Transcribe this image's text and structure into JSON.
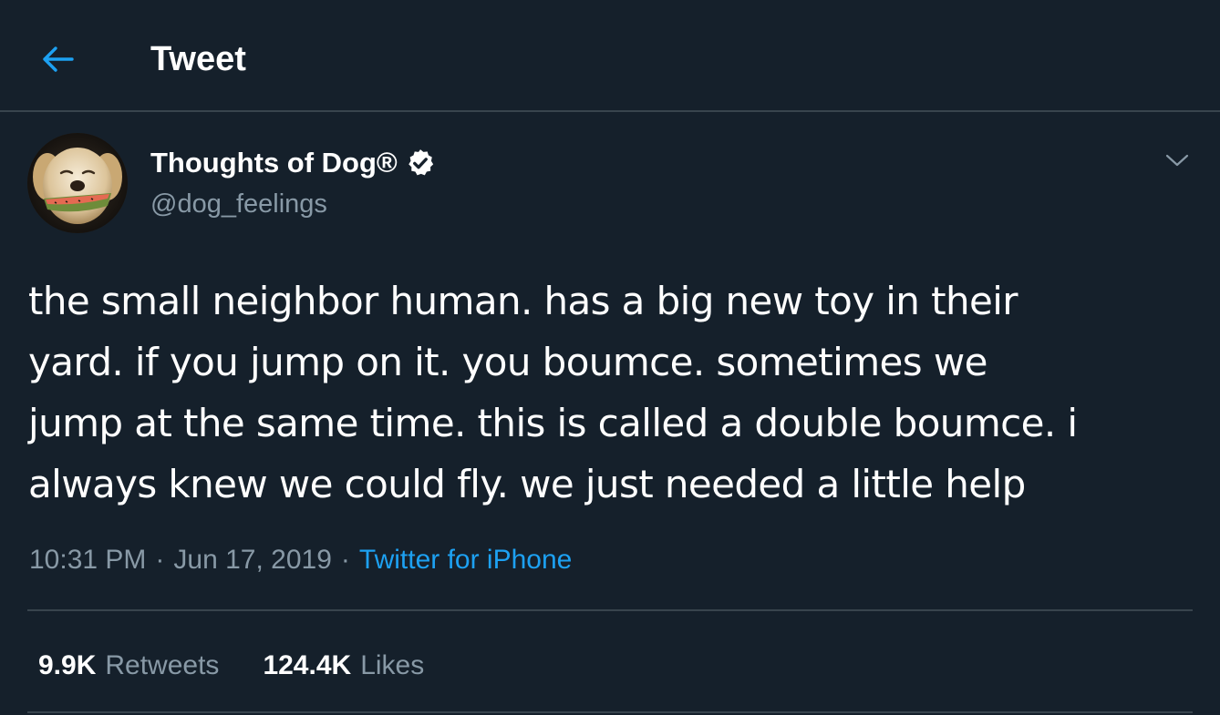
{
  "header": {
    "title": "Tweet",
    "back_icon": "arrow-left-icon",
    "accent_color": "#1da1f2"
  },
  "author": {
    "name": "Thoughts of Dog®",
    "handle": "@dog_feelings",
    "verified": true
  },
  "tweet": {
    "text_lines": [
      "the small neighbor human. has a big new toy in their",
      "yard. if you jump on it. you boumce. sometimes we",
      "jump at the same time. this is called a double boumce. i",
      "always knew we could fly. we just needed a little help"
    ],
    "time": "10:31 PM",
    "date": "Jun 17, 2019",
    "separator": "·",
    "source": "Twitter for iPhone"
  },
  "stats": {
    "retweets_count": "9.9K",
    "retweets_label": "Retweets",
    "likes_count": "124.4K",
    "likes_label": "Likes"
  },
  "colors": {
    "background": "#15202b",
    "border": "#38444d",
    "secondary_text": "#8899a6",
    "link": "#1da1f2"
  }
}
